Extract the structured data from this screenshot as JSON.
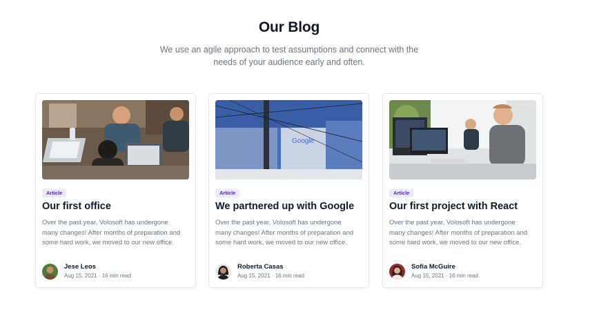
{
  "blog": {
    "title": "Our Blog",
    "subtitle": "We use an agile approach to test assumptions and connect with the needs of your audience early and often.",
    "posts": [
      {
        "badge": "Article",
        "title": "Our first office",
        "excerpt": "Over the past year, Volosoft has undergone many changes! After months of preparation and some hard work, we moved to our new office.",
        "author": "Jese Leos",
        "meta": "Aug 15, 2021 · 16 min read",
        "image": "office-team-laptops-photo"
      },
      {
        "badge": "Article",
        "title": "We partnered up with Google",
        "excerpt": "Over the past year, Volosoft has undergone many changes! After months of preparation and some hard work, we moved to our new office.",
        "author": "Roberta Casas",
        "meta": "Aug 15, 2021 · 16 min read",
        "image": "google-building-photo",
        "image_sign_text": "Google"
      },
      {
        "badge": "Article",
        "title": "Our first project with React",
        "excerpt": "Over the past year, Volosoft has undergone many changes! After months of preparation and some hard work, we moved to our new office.",
        "author": "Sofia McGuire",
        "meta": "Aug 15, 2021 · 16 min read",
        "image": "developers-at-desk-photo"
      }
    ]
  },
  "colors": {
    "badge_bg": "#ede9fe",
    "badge_text": "#5b21b6",
    "title": "#111827",
    "body_text": "#6b7280"
  }
}
